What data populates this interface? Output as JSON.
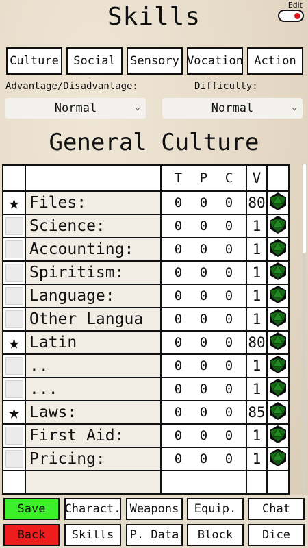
{
  "header": {
    "title": "Skills",
    "edit_label": "Edit"
  },
  "tabs": [
    {
      "label": "Culture"
    },
    {
      "label": "Social"
    },
    {
      "label": "Sensory"
    },
    {
      "label": "Vocation"
    },
    {
      "label": "Action"
    }
  ],
  "filters": {
    "advantage_label": "Advantage/Disadvantage:",
    "advantage_value": "Normal",
    "difficulty_label": "Difficulty:",
    "difficulty_value": "Normal"
  },
  "section": {
    "title": "General Culture"
  },
  "table": {
    "headers": {
      "t": "T",
      "p": "P",
      "c": "C",
      "v": "V"
    },
    "rows": [
      {
        "starred": true,
        "name": "Files:",
        "t": "0",
        "p": "0",
        "c": "0",
        "v": "80"
      },
      {
        "starred": false,
        "name": "Science:",
        "t": "0",
        "p": "0",
        "c": "0",
        "v": "1"
      },
      {
        "starred": false,
        "name": "Accounting:",
        "t": "0",
        "p": "0",
        "c": "0",
        "v": "1"
      },
      {
        "starred": false,
        "name": "Spiritism:",
        "t": "0",
        "p": "0",
        "c": "0",
        "v": "1"
      },
      {
        "starred": false,
        "name": "Language:",
        "t": "0",
        "p": "0",
        "c": "0",
        "v": "1"
      },
      {
        "starred": false,
        "name": "Other Langua",
        "t": "0",
        "p": "0",
        "c": "0",
        "v": "1"
      },
      {
        "starred": true,
        "name": "Latin",
        "t": "0",
        "p": "0",
        "c": "0",
        "v": "80"
      },
      {
        "starred": false,
        "name": "..",
        "t": "0",
        "p": "0",
        "c": "0",
        "v": "1"
      },
      {
        "starred": false,
        "name": "...",
        "t": "0",
        "p": "0",
        "c": "0",
        "v": "1"
      },
      {
        "starred": true,
        "name": "Laws:",
        "t": "0",
        "p": "0",
        "c": "0",
        "v": "85"
      },
      {
        "starred": false,
        "name": "First Aid:",
        "t": "0",
        "p": "0",
        "c": "0",
        "v": "1"
      },
      {
        "starred": false,
        "name": "Pricing:",
        "t": "0",
        "p": "0",
        "c": "0",
        "v": "1"
      },
      {
        "starred": false,
        "name": "",
        "t": "",
        "p": "",
        "c": "",
        "v": ""
      }
    ],
    "icons": {
      "star": "star-icon",
      "dice": "d20-dice-icon"
    }
  },
  "bottom": {
    "save": "Save",
    "back": "Back",
    "charact": "Charact.",
    "skills": "Skills",
    "weapons": "Weapons",
    "pdata": "P. Data",
    "equip": "Equip.",
    "block": "Block",
    "chat": "Chat",
    "dice": "Dice"
  },
  "colors": {
    "save": "#3cf02b",
    "back": "#ee1c1c",
    "toggle_dot": "#e01b1b",
    "dice": "#1f8a1f"
  }
}
